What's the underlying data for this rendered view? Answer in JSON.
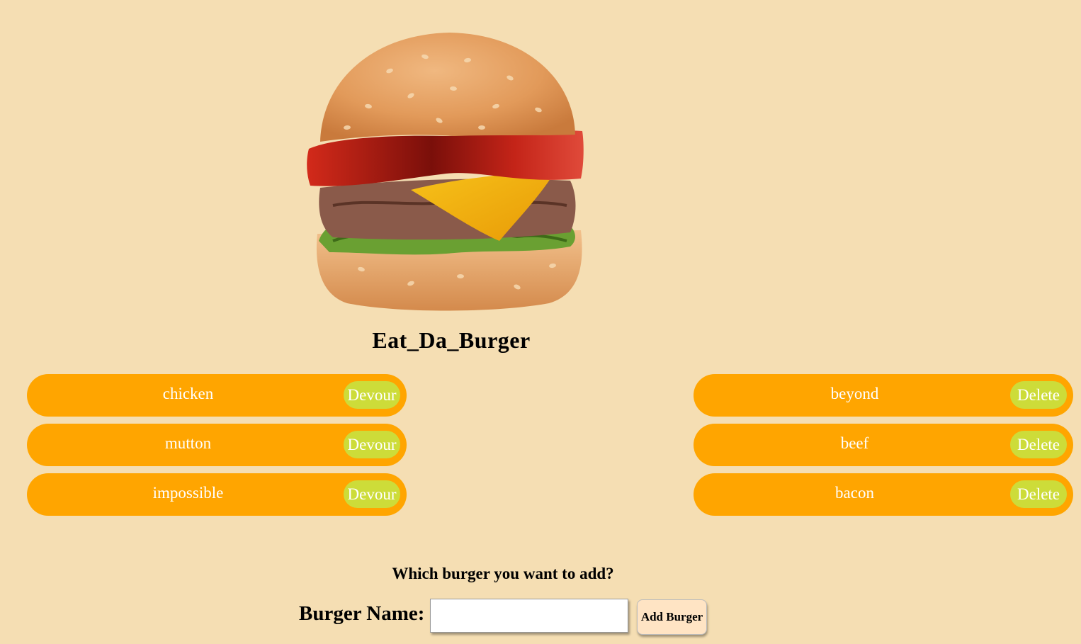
{
  "header": {
    "title": "Eat_Da_Burger"
  },
  "burgers_available": [
    {
      "name": "chicken",
      "action": "Devour"
    },
    {
      "name": "mutton",
      "action": "Devour"
    },
    {
      "name": "impossible",
      "action": "Devour"
    }
  ],
  "burgers_devoured": [
    {
      "name": "beyond",
      "action": "Delete"
    },
    {
      "name": "beef",
      "action": "Delete"
    },
    {
      "name": "bacon",
      "action": "Delete"
    }
  ],
  "form": {
    "question": "Which burger you want to add?",
    "name_label": "Burger Name:",
    "name_value": "",
    "submit_label": "Add Burger"
  },
  "colors": {
    "background": "#f5deb3",
    "pill": "#ffa500",
    "pill_button": "#cddc39",
    "add_button": "#ffe4c4"
  },
  "icons": {
    "hero": "burger-illustration"
  }
}
